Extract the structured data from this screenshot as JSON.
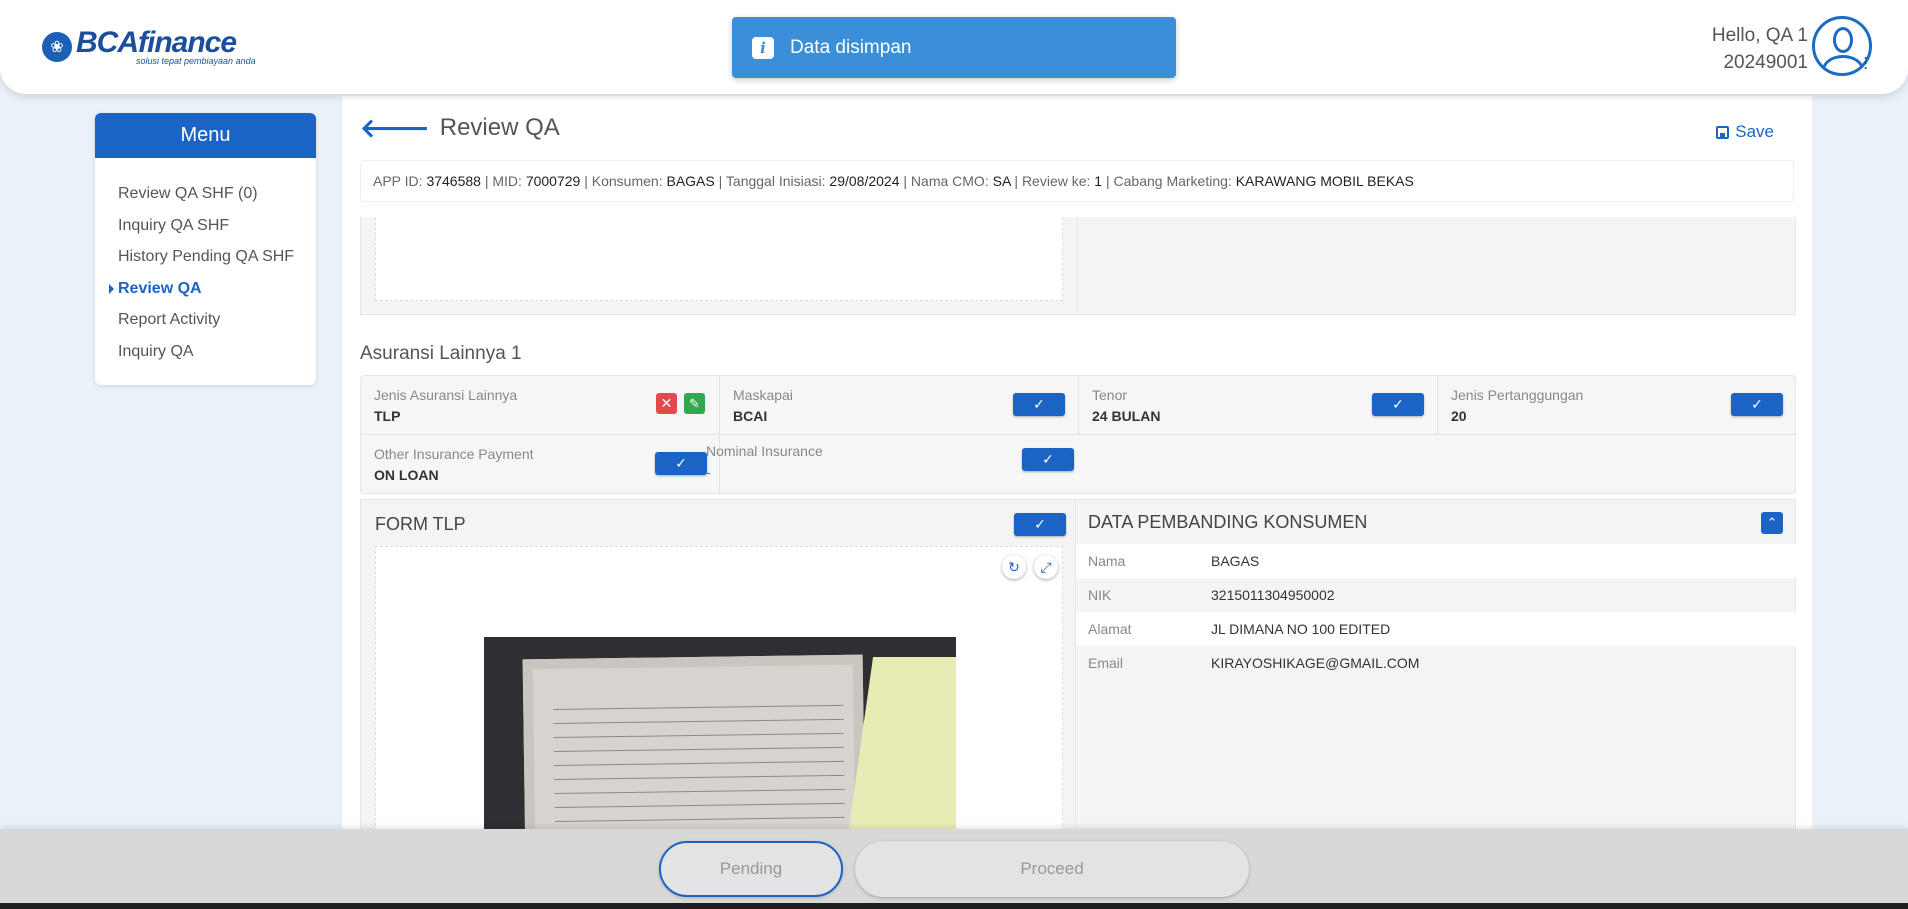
{
  "brand": {
    "name_part1": "BCA",
    "name_part2": "finance",
    "tagline": "solusi tepat pembiayaan anda",
    "color": "#1b4f9e"
  },
  "toast": {
    "icon": "info-icon",
    "message": "Data disimpan",
    "color": "#3a8fd8"
  },
  "user": {
    "greeting": "Hello, QA 1",
    "id": "20249001"
  },
  "sidebar": {
    "title": "Menu",
    "items": [
      {
        "label": "Review QA SHF (0)"
      },
      {
        "label": "Inquiry QA SHF"
      },
      {
        "label": "History Pending QA SHF"
      },
      {
        "label": "Review QA",
        "active": true
      },
      {
        "label": "Report Activity"
      },
      {
        "label": "Inquiry QA"
      }
    ]
  },
  "page": {
    "title": "Review QA",
    "save_label": "Save"
  },
  "info": {
    "app_id_label": "APP ID:",
    "app_id": "3746588",
    "mid_label": "MID:",
    "mid": "7000729",
    "konsumen_label": "Konsumen:",
    "konsumen": "BAGAS",
    "tanggal_label": "Tanggal Inisiasi:",
    "tanggal": "29/08/2024",
    "cmo_label": "Nama CMO:",
    "cmo": "SA",
    "review_label": "Review ke:",
    "review": "1",
    "cabang_label": "Cabang Marketing:",
    "cabang": "KARAWANG MOBIL BEKAS"
  },
  "asuransi": {
    "section_title": "Asuransi Lainnya 1",
    "fields": [
      {
        "label": "Jenis Asuransi Lainnya",
        "value": "TLP"
      },
      {
        "label": "Maskapai",
        "value": "BCAI"
      },
      {
        "label": "Tenor",
        "value": "24 BULAN"
      },
      {
        "label": "Jenis Pertanggungan",
        "value": "20"
      },
      {
        "label": "Other Insurance Payment",
        "value": "ON LOAN"
      },
      {
        "label": "Nominal Insurance",
        "value": "-"
      }
    ]
  },
  "form_tlp": {
    "title": "FORM TLP"
  },
  "pembanding": {
    "title": "DATA PEMBANDING KONSUMEN",
    "rows": [
      {
        "key": "Nama",
        "value": "BAGAS"
      },
      {
        "key": "NIK",
        "value": "3215011304950002"
      },
      {
        "key": "Alamat",
        "value": "JL DIMANA NO 100 EDITED"
      },
      {
        "key": "Email",
        "value": "KIRAYOSHIKAGE@GMAIL.COM"
      }
    ]
  },
  "footer": {
    "pending_label": "Pending",
    "proceed_label": "Proceed"
  },
  "colors": {
    "primary": "#1b64c6",
    "danger": "#e04a4a",
    "success": "#2fa84f"
  }
}
